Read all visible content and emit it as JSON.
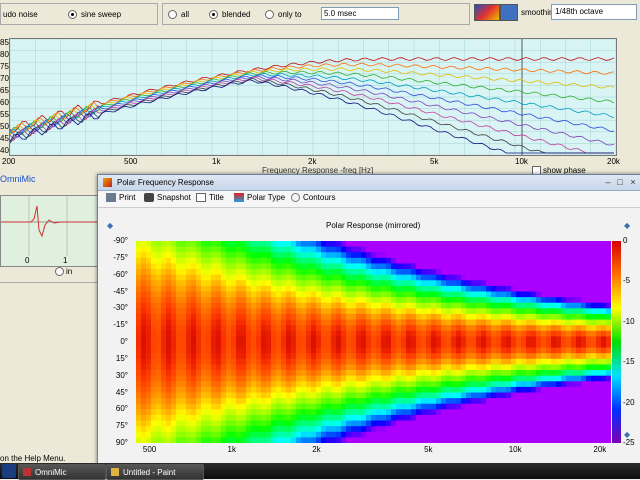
{
  "back_window": {
    "noise_label": "udo noise",
    "sweep_label": "sine sweep",
    "all_label": "all",
    "blended_label": "blended",
    "only_to_label": "only to",
    "msec_value": "5.0 msec",
    "smoothing_label": "smoothing",
    "smoothing_value": "1/48th octave",
    "plot_title": "Frequency Response -freq [Hz]",
    "y_ticks": [
      "85",
      "80",
      "75",
      "70",
      "65",
      "60",
      "55",
      "50",
      "45",
      "40"
    ],
    "x_ticks": [
      "200",
      "500",
      "1k",
      "2k",
      "5k",
      "10k",
      "20k"
    ],
    "show_phase_label": "show phase",
    "omnimic_label": "OmniMic",
    "impulse_ticks": [
      "0",
      "1"
    ],
    "in_label": "in",
    "status_text": "on the Help Menu."
  },
  "front_window": {
    "title": "Polar Frequency Response",
    "toolbar": {
      "print": "Print",
      "snapshot": "Snapshot",
      "title": "Title",
      "polar_type": "Polar Type",
      "contours": "Contours"
    },
    "chart_title": "Polar Response (mirrored)"
  },
  "chart_data": {
    "type": "heatmap",
    "title": "Polar Response (mirrored)",
    "y_ticks": [
      "-90°",
      "-75°",
      "-60°",
      "-45°",
      "-30°",
      "-15°",
      "0°",
      "15°",
      "30°",
      "45°",
      "60°",
      "75°",
      "90°"
    ],
    "y_values": [
      -90,
      -75,
      -60,
      -45,
      -30,
      -15,
      0,
      15,
      30,
      45,
      60,
      75,
      90
    ],
    "x_ticks": [
      "500",
      "1k",
      "2k",
      "5k",
      "10k",
      "20k"
    ],
    "x_values": [
      500,
      1000,
      2000,
      5000,
      10000,
      20000
    ],
    "x_scale": "log",
    "x_range": [
      450,
      22000
    ],
    "colorbar_ticks": [
      "0",
      "-5",
      "-10",
      "-15",
      "-20",
      "-25"
    ],
    "colorbar_values": [
      0,
      -5,
      -10,
      -15,
      -20,
      -25
    ],
    "colorbar_range": [
      0,
      -25
    ],
    "colors": {
      "max": "#d40000",
      "min": "#7a00b0"
    }
  },
  "taskbar": {
    "items": [
      "OmniMic",
      "Untitled - Paint"
    ]
  }
}
